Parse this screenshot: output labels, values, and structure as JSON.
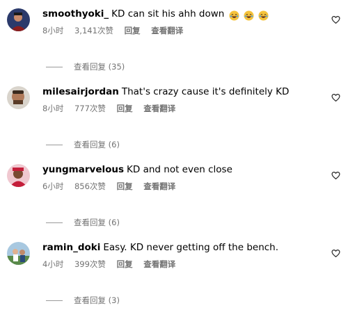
{
  "comments": [
    {
      "username": "smoothyoki_",
      "text": "KD can sit his ahh down",
      "emojis": [
        "rolling-laughing-emoji",
        "rolling-laughing-emoji",
        "rolling-laughing-emoji"
      ],
      "time": "8小时",
      "likes": "3,141次赞",
      "reply_label": "回复",
      "translate_label": "查看翻译",
      "view_replies": "查看回复 (35)"
    },
    {
      "username": "milesairjordan",
      "text": "That's crazy cause it's definitely KD",
      "emojis": [],
      "time": "8小时",
      "likes": "777次赞",
      "reply_label": "回复",
      "translate_label": "查看翻译",
      "view_replies": "查看回复 (6)"
    },
    {
      "username": "yungmarvelous",
      "text": "KD and not even close",
      "emojis": [],
      "time": "6小时",
      "likes": "856次赞",
      "reply_label": "回复",
      "translate_label": "查看翻译",
      "view_replies": "查看回复 (6)"
    },
    {
      "username": "ramin_doki",
      "text": "Easy. KD never getting off the bench.",
      "emojis": [],
      "time": "4小时",
      "likes": "399次赞",
      "reply_label": "回复",
      "translate_label": "查看翻译",
      "view_replies": "查看回复 (3)"
    }
  ],
  "colors": {
    "meta_text": "#737373",
    "divider": "#9a9a9a",
    "heart_stroke": "#262626",
    "emoji_face": "#f5c33b"
  },
  "icons": {
    "like": "heart-icon",
    "emoji": "rolling-laughing-emoji"
  }
}
